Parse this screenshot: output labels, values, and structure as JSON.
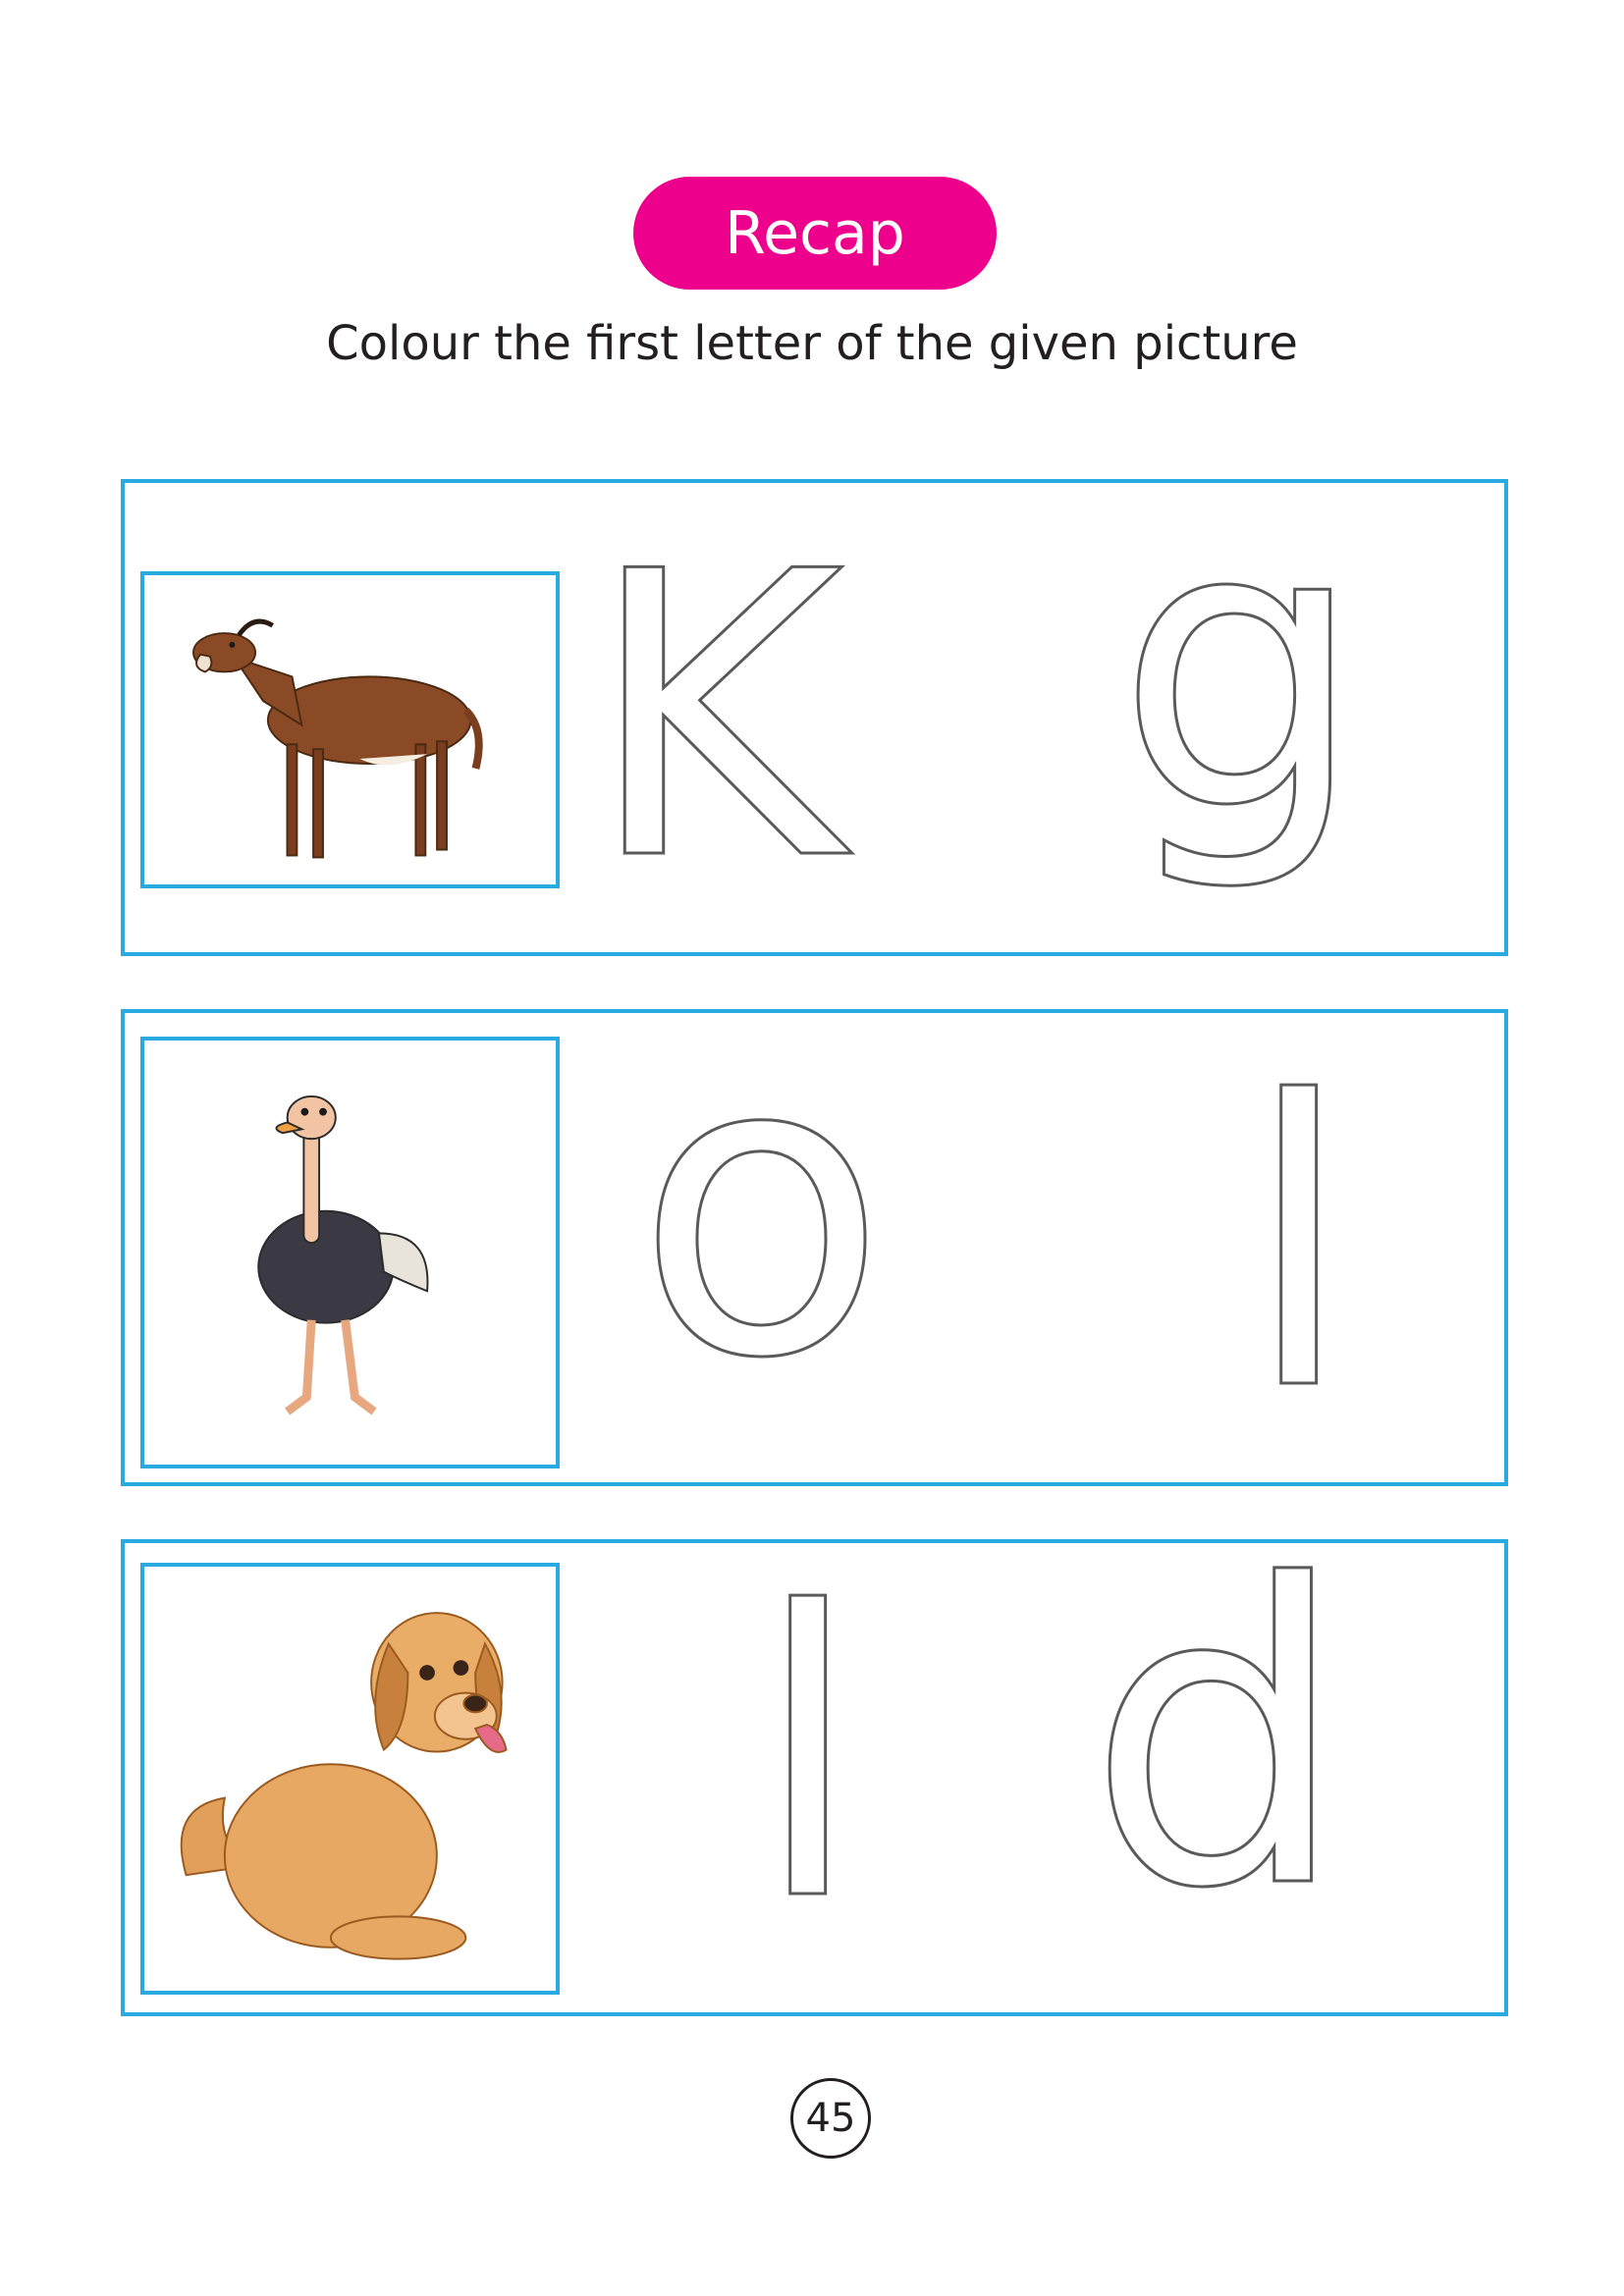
{
  "header": {
    "badge": "Recap"
  },
  "instruction": "Colour the first letter of the given picture",
  "rows": [
    {
      "picture": "goat-illustration",
      "letters": [
        "K",
        "g"
      ]
    },
    {
      "picture": "ostrich-illustration",
      "letters": [
        "o",
        "l"
      ]
    },
    {
      "picture": "dog-illustration",
      "letters": [
        "l",
        "d"
      ]
    }
  ],
  "page_number": "45",
  "colors": {
    "badge": "#ec008c",
    "frame": "#29abe2",
    "text": "#231f20"
  }
}
